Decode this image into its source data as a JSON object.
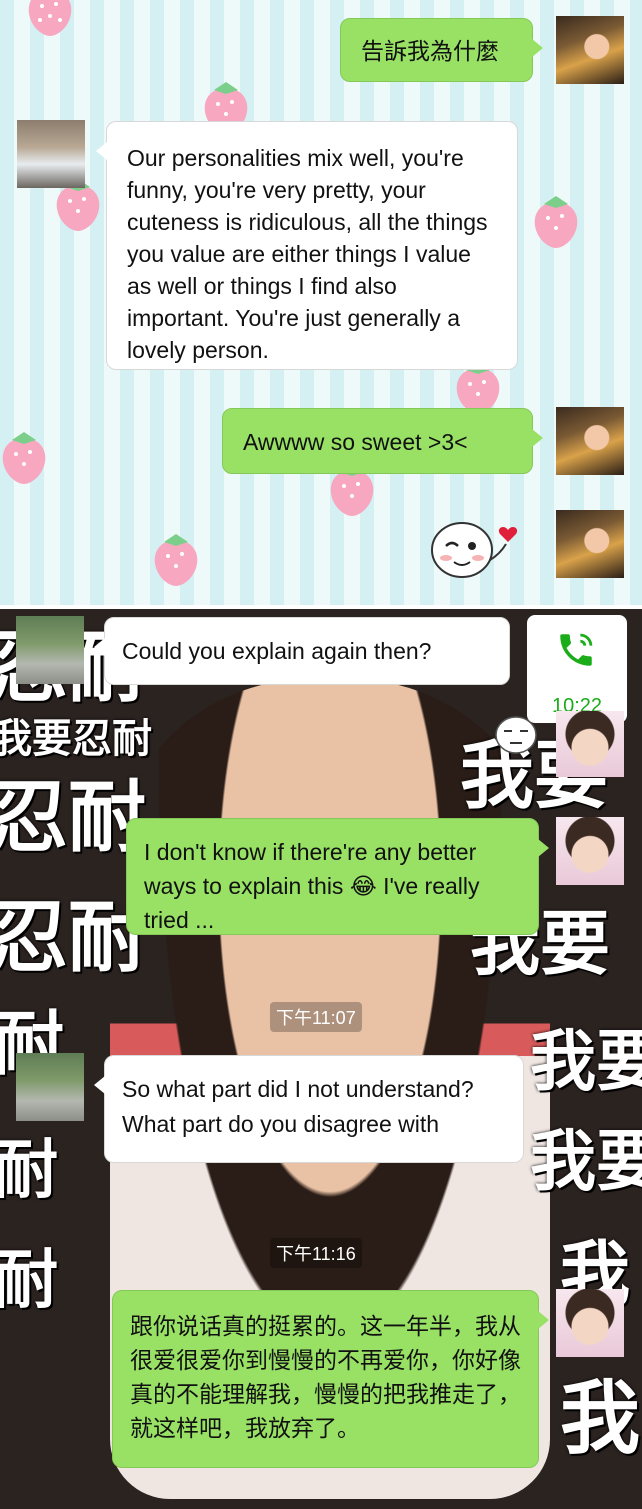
{
  "top_chat": {
    "messages": [
      {
        "side": "right",
        "text": "告訴我為什麼"
      },
      {
        "side": "left",
        "text": "Our personalities mix well, you're funny, you're very pretty, your cuteness is ridiculous, all the things you value are either things I value as well or things I find also important. You're just generally a lovely person."
      },
      {
        "side": "right",
        "text": "Awwww so sweet >3<"
      }
    ],
    "sticker_icon": "winking-face-heart-sticker"
  },
  "bottom_chat": {
    "call_time": "10:22",
    "messages": [
      {
        "side": "left",
        "text": "Could you explain again then?"
      },
      {
        "side": "right",
        "text": "I don't know if there're any better ways to explain this 😂 I've really tried ..."
      },
      {
        "side": "left",
        "text": "So what part did I not understand? What part do you disagree with"
      },
      {
        "side": "right",
        "text": "跟你说话真的挺累的。这一年半，我从很爱很爱你到慢慢的不再爱你，你好像真的不能理解我，慢慢的把我推走了，就这样吧，我放弃了。"
      }
    ],
    "timestamps": [
      "下午11:07",
      "下午11:16"
    ],
    "meme_text": [
      "忍耐",
      "我要忍耐",
      "忍耐",
      "忍耐",
      "耐",
      "耐",
      "耐",
      "我要",
      "我要",
      "我要",
      "我要",
      "我",
      "我"
    ]
  },
  "colors": {
    "green_bubble": "#98e165",
    "white_bubble": "#ffffff",
    "call_icon": "#1aad19"
  }
}
